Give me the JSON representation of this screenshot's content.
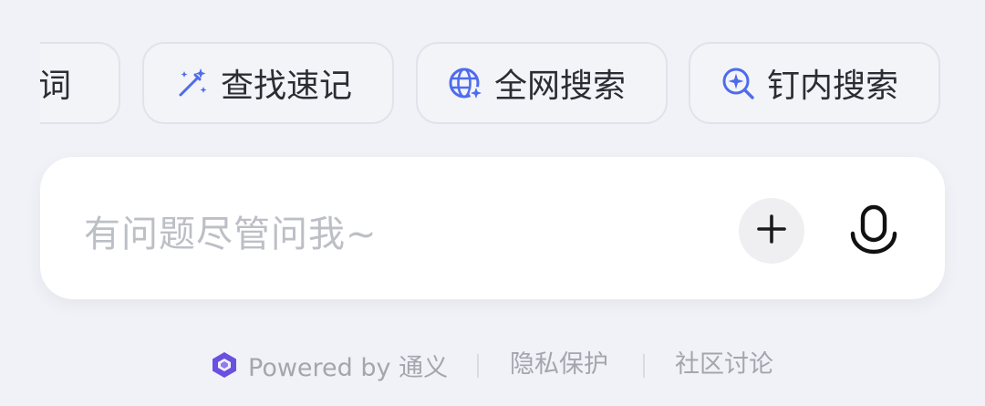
{
  "quick_actions": [
    {
      "label": "示词",
      "icon": "prompt-icon"
    },
    {
      "label": "查找速记",
      "icon": "magic-wand-icon"
    },
    {
      "label": "全网搜索",
      "icon": "globe-sparkle-icon"
    },
    {
      "label": "钉内搜索",
      "icon": "search-sparkle-icon"
    }
  ],
  "input": {
    "placeholder": "有问题尽管问我~"
  },
  "actions": {
    "plus_icon": "plus-icon",
    "mic_icon": "microphone-icon"
  },
  "footer": {
    "powered_by": "Powered by 通义",
    "privacy": "隐私保护",
    "community": "社区讨论"
  },
  "colors": {
    "background": "#f1f2f7",
    "accent": "#4f6bed",
    "logo_purple": "#6b4fe0"
  }
}
